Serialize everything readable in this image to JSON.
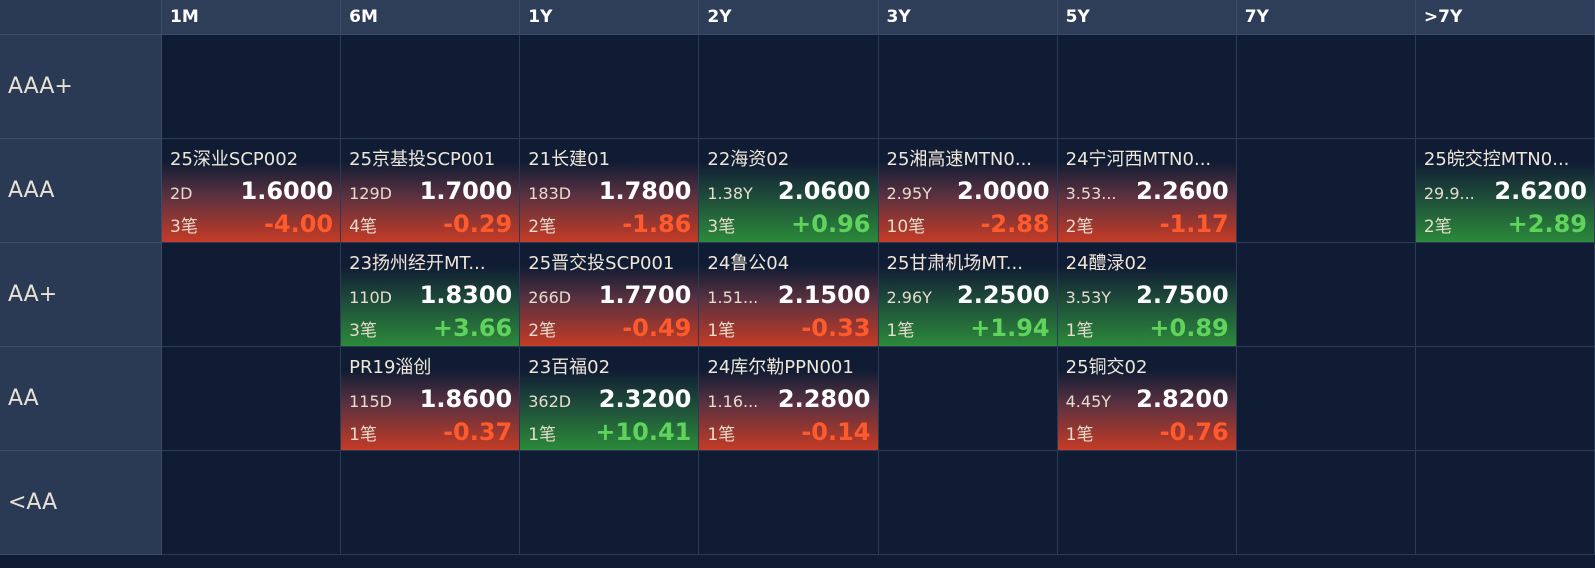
{
  "columns": [
    "1M",
    "6M",
    "1Y",
    "2Y",
    "3Y",
    "5Y",
    "7Y",
    ">7Y"
  ],
  "colors": {
    "negative": "#ff5a2b",
    "positive": "#5fd35c",
    "background": "#101c33",
    "header": "#2e3d58"
  },
  "rows": [
    {
      "label": "AAA+",
      "cells": [
        null,
        null,
        null,
        null,
        null,
        null,
        null,
        null
      ]
    },
    {
      "label": "AAA",
      "cells": [
        {
          "name": "25深业SCP002",
          "term": "2D",
          "rate": "1.6000",
          "count": "3笔",
          "change": "-4.00",
          "dir": "neg"
        },
        {
          "name": "25京基投SCP001",
          "term": "129D",
          "rate": "1.7000",
          "count": "4笔",
          "change": "-0.29",
          "dir": "neg"
        },
        {
          "name": "21长建01",
          "term": "183D",
          "rate": "1.7800",
          "count": "2笔",
          "change": "-1.86",
          "dir": "neg"
        },
        {
          "name": "22海资02",
          "term": "1.38Y",
          "rate": "2.0600",
          "count": "3笔",
          "change": "+0.96",
          "dir": "pos"
        },
        {
          "name": "25湘高速MTN0...",
          "term": "2.95Y",
          "rate": "2.0000",
          "count": "10笔",
          "change": "-2.88",
          "dir": "neg"
        },
        {
          "name": "24宁河西MTN0...",
          "term": "3.53...",
          "rate": "2.2600",
          "count": "2笔",
          "change": "-1.17",
          "dir": "neg"
        },
        null,
        {
          "name": "25皖交控MTN0...",
          "term": "29.9...",
          "rate": "2.6200",
          "count": "2笔",
          "change": "+2.89",
          "dir": "pos"
        }
      ]
    },
    {
      "label": "AA+",
      "cells": [
        null,
        {
          "name": "23扬州经开MT...",
          "term": "110D",
          "rate": "1.8300",
          "count": "3笔",
          "change": "+3.66",
          "dir": "pos"
        },
        {
          "name": "25晋交投SCP001",
          "term": "266D",
          "rate": "1.7700",
          "count": "2笔",
          "change": "-0.49",
          "dir": "neg"
        },
        {
          "name": "24鲁公04",
          "term": "1.51...",
          "rate": "2.1500",
          "count": "1笔",
          "change": "-0.33",
          "dir": "neg"
        },
        {
          "name": "25甘肃机场MT...",
          "term": "2.96Y",
          "rate": "2.2500",
          "count": "1笔",
          "change": "+1.94",
          "dir": "pos"
        },
        {
          "name": "24醴渌02",
          "term": "3.53Y",
          "rate": "2.7500",
          "count": "1笔",
          "change": "+0.89",
          "dir": "pos"
        },
        null,
        null
      ]
    },
    {
      "label": "AA",
      "cells": [
        null,
        {
          "name": "PR19淄创",
          "term": "115D",
          "rate": "1.8600",
          "count": "1笔",
          "change": "-0.37",
          "dir": "neg"
        },
        {
          "name": "23百福02",
          "term": "362D",
          "rate": "2.3200",
          "count": "1笔",
          "change": "+10.41",
          "dir": "pos"
        },
        {
          "name": "24库尔勒PPN001",
          "term": "1.16...",
          "rate": "2.2800",
          "count": "1笔",
          "change": "-0.14",
          "dir": "neg"
        },
        null,
        {
          "name": "25铜交02",
          "term": "4.45Y",
          "rate": "2.8200",
          "count": "1笔",
          "change": "-0.76",
          "dir": "neg"
        },
        null,
        null
      ]
    },
    {
      "label": "<AA",
      "cells": [
        null,
        null,
        null,
        null,
        null,
        null,
        null,
        null
      ]
    }
  ]
}
